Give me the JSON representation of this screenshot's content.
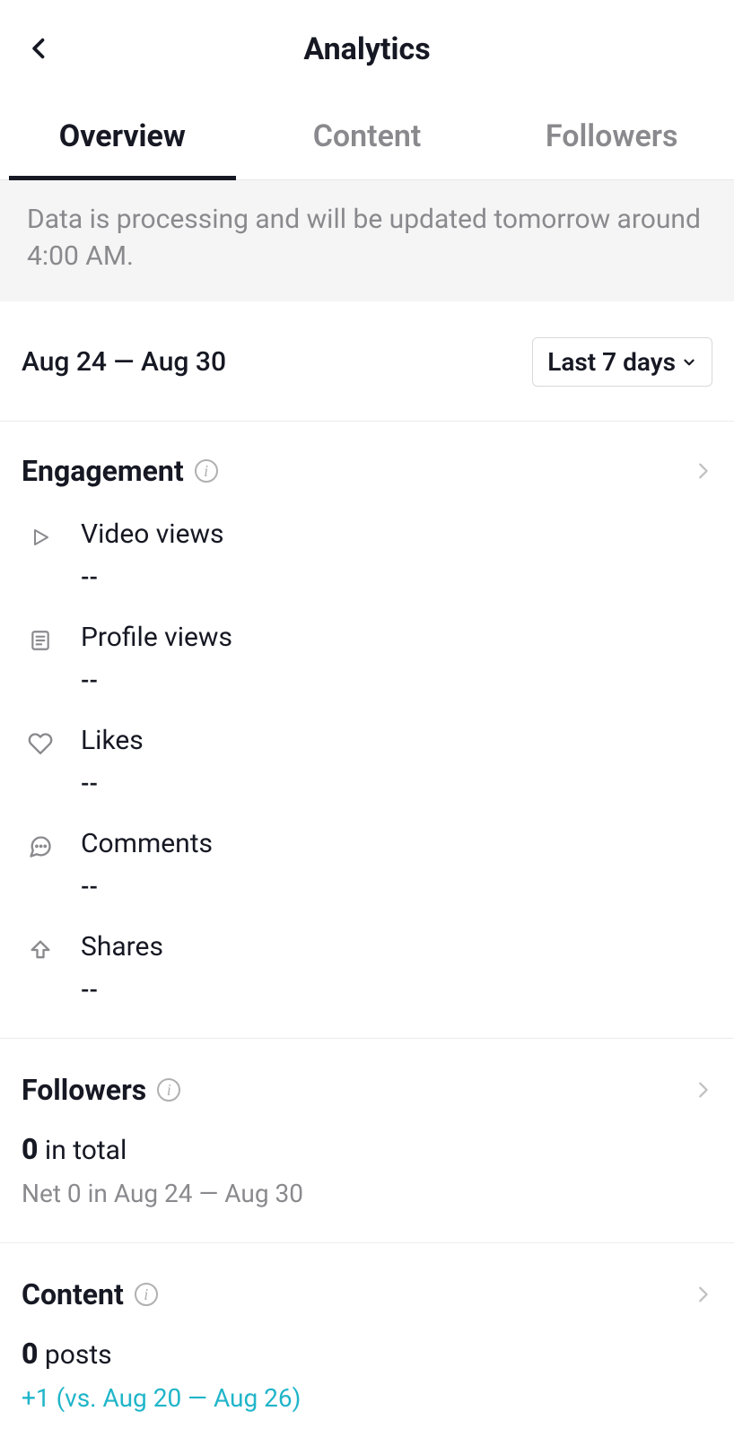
{
  "header": {
    "title": "Analytics"
  },
  "tabs": {
    "overview": "Overview",
    "content": "Content",
    "followers": "Followers",
    "active": "overview"
  },
  "notice": "Data is processing and will be updated tomorrow around 4:00 AM.",
  "dateRange": "Aug 24 — Aug 30",
  "rangeSelector": {
    "label": "Last 7 days"
  },
  "engagement": {
    "title": "Engagement",
    "metrics": {
      "videoViews": {
        "label": "Video views",
        "value": "--"
      },
      "profileViews": {
        "label": "Profile views",
        "value": "--"
      },
      "likes": {
        "label": "Likes",
        "value": "--"
      },
      "comments": {
        "label": "Comments",
        "value": "--"
      },
      "shares": {
        "label": "Shares",
        "value": "--"
      }
    }
  },
  "followersSection": {
    "title": "Followers",
    "totalNumber": "0",
    "totalSuffix": " in total",
    "netLine": "Net 0 in Aug 24 — Aug 30"
  },
  "contentSection": {
    "title": "Content",
    "postsNumber": "0",
    "postsSuffix": " posts",
    "deltaLine": "+1 (vs. Aug 20 — Aug 26)"
  }
}
